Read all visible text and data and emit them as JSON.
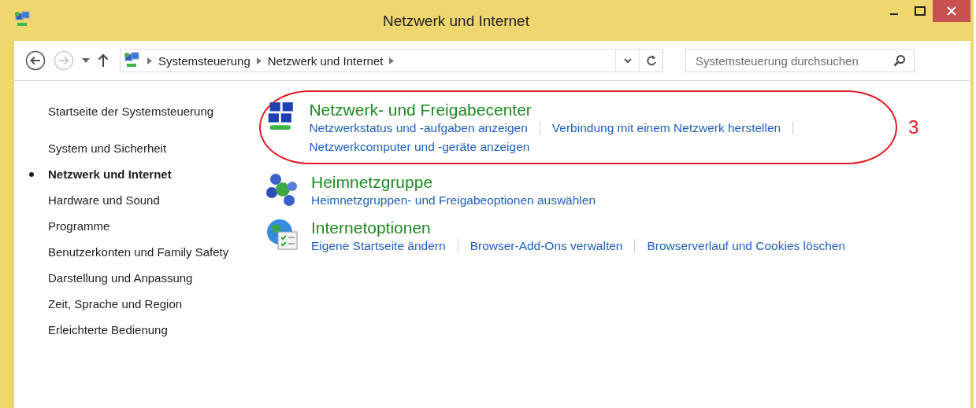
{
  "window": {
    "title": "Netzwerk und Internet"
  },
  "toolbar": {
    "back_disabled": false,
    "forward_disabled": true,
    "breadcrumbs": [
      "Systemsteuerung",
      "Netzwerk und Internet"
    ],
    "search": {
      "placeholder": "Systemsteuerung durchsuchen"
    }
  },
  "sidebar": {
    "home": "Startseite der Systemsteuerung",
    "items": [
      {
        "label": "System und Sicherheit",
        "selected": false
      },
      {
        "label": "Netzwerk und Internet",
        "selected": true
      },
      {
        "label": "Hardware und Sound",
        "selected": false
      },
      {
        "label": "Programme",
        "selected": false
      },
      {
        "label": "Benutzerkonten und Family Safety",
        "selected": false
      },
      {
        "label": "Darstellung und Anpassung",
        "selected": false
      },
      {
        "label": "Zeit, Sprache und Region",
        "selected": false
      },
      {
        "label": "Erleichterte Bedienung",
        "selected": false
      }
    ]
  },
  "sections": [
    {
      "kind": "network",
      "title": "Netzwerk- und Freigabecenter",
      "annotated": true,
      "links": [
        "Netzwerkstatus und -aufgaben anzeigen",
        "Verbindung mit einem Netzwerk herstellen",
        "Netzwerkcomputer und -geräte anzeigen"
      ]
    },
    {
      "kind": "homegroup",
      "title": "Heimnetzgruppe",
      "annotated": false,
      "links": [
        "Heimnetzgruppen- und Freigabeoptionen auswählen"
      ]
    },
    {
      "kind": "internet",
      "title": "Internetoptionen",
      "annotated": false,
      "links": [
        "Eigene Startseite ändern",
        "Browser-Add-Ons verwalten",
        "Browserverlauf und Cookies löschen"
      ]
    }
  ],
  "annotation": {
    "label": "3"
  }
}
